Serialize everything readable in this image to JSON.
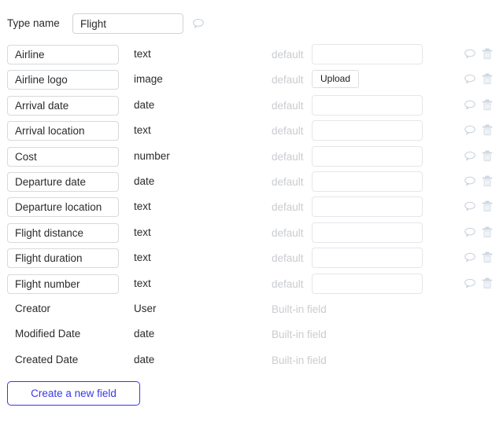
{
  "header": {
    "type_name_label": "Type name",
    "type_name_value": "Flight",
    "type_name_placeholder": "",
    "comment_icon": "speech-bubble-icon"
  },
  "columns": {
    "default_label": "default",
    "builtin_label": "Built-in field"
  },
  "colors": {
    "accent": "#3a37ea",
    "muted_text": "#c9ccd0",
    "icon": "#ccd4dd",
    "border": "#d6d9dc",
    "text": "#2b2b2b"
  },
  "icons": {
    "comment": "speech-bubble-icon",
    "delete": "trash-icon"
  },
  "fields": [
    {
      "name": "Airline",
      "type": "text",
      "default_label": "default",
      "control": "input",
      "default_value": ""
    },
    {
      "name": "Airline logo",
      "type": "image",
      "default_label": "default",
      "control": "upload",
      "upload_label": "Upload"
    },
    {
      "name": "Arrival date",
      "type": "date",
      "default_label": "default",
      "control": "input",
      "default_value": ""
    },
    {
      "name": "Arrival location",
      "type": "text",
      "default_label": "default",
      "control": "input",
      "default_value": ""
    },
    {
      "name": "Cost",
      "type": "number",
      "default_label": "default",
      "control": "input",
      "default_value": ""
    },
    {
      "name": "Departure date",
      "type": "date",
      "default_label": "default",
      "control": "input",
      "default_value": ""
    },
    {
      "name": "Departure location",
      "type": "text",
      "default_label": "default",
      "control": "input",
      "default_value": ""
    },
    {
      "name": "Flight distance",
      "type": "text",
      "default_label": "default",
      "control": "input",
      "default_value": ""
    },
    {
      "name": "Flight duration",
      "type": "text",
      "default_label": "default",
      "control": "input",
      "default_value": ""
    },
    {
      "name": "Flight number",
      "type": "text",
      "default_label": "default",
      "control": "input",
      "default_value": ""
    }
  ],
  "builtin_fields": [
    {
      "name": "Creator",
      "type": "User",
      "note": "Built-in field"
    },
    {
      "name": "Modified Date",
      "type": "date",
      "note": "Built-in field"
    },
    {
      "name": "Created Date",
      "type": "date",
      "note": "Built-in field"
    }
  ],
  "footer": {
    "create_field_label": "Create a new field"
  }
}
